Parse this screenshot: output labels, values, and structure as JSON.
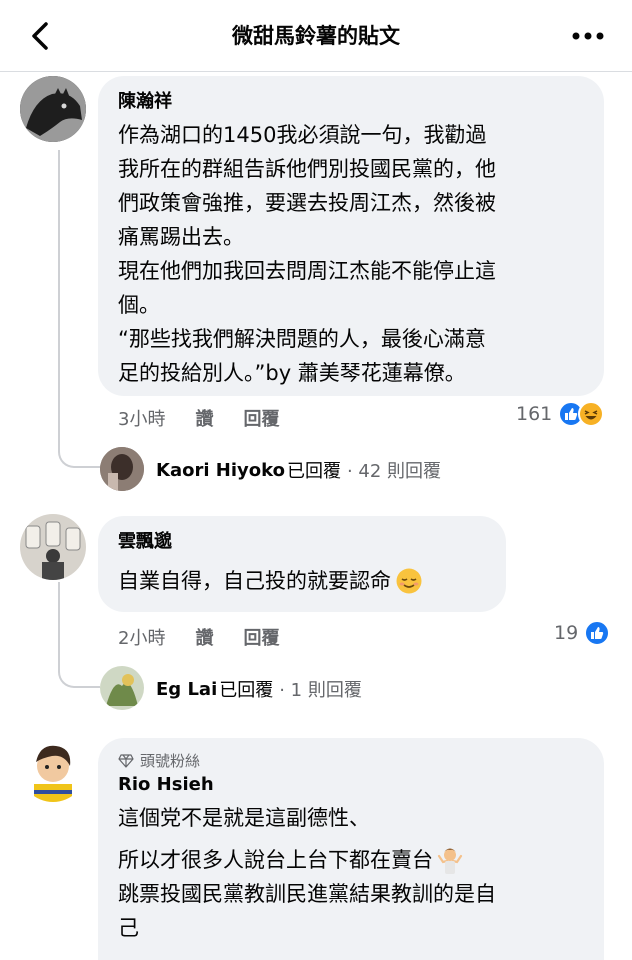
{
  "header": {
    "title": "微甜馬鈴薯的貼文"
  },
  "comments": [
    {
      "author": "陳瀚祥",
      "text": "作為湖口的1450我必須說一句，我勸過\n我所在的群組告訴他們別投國民黨的，他\n們政策會強推，要選去投周江杰，然後被\n痛罵踢出去。\n現在他們加我回去問周江杰能不能停止這\n個。\n“那些找我們解決問題的人，最後心滿意\n足的投給別人。”by 蕭美琴花蓮幕僚。",
      "time": "3小時",
      "like_label": "讚",
      "reply_label": "回覆",
      "reaction_count": "161",
      "reply_summary": {
        "name": "Kaori Hiyoko",
        "replied": "已回覆",
        "count": "· 42 則回覆"
      }
    },
    {
      "author": "雲飄邈",
      "text": "自業自得，自己投的就要認命",
      "time": "2小時",
      "like_label": "讚",
      "reply_label": "回覆",
      "reaction_count": "19",
      "reply_summary": {
        "name": "Eg Lai",
        "replied": "已回覆",
        "count": "· 1 則回覆"
      }
    },
    {
      "badge": "頭號粉絲",
      "author": "Rio Hsieh",
      "lines": [
        "這個党不是就是這副德性、",
        "所以才很多人說台上台下都在賣台",
        "跳票投國民黨教訓民進黨結果教訓的是自\n己"
      ]
    }
  ],
  "colors": {
    "bubble": "#f0f2f5",
    "like": "#1877f2",
    "meta": "#65676b"
  }
}
